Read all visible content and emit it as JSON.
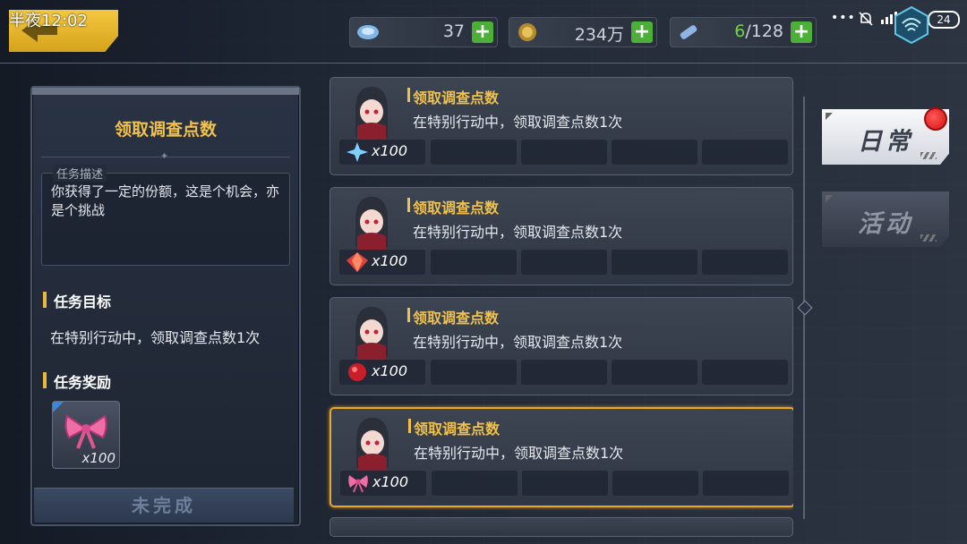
{
  "statusbar": {
    "time": "半夜12:02",
    "dots": "•••",
    "battery": "24"
  },
  "resources": [
    {
      "icon": "crystal-icon",
      "value": "37",
      "highlight": ""
    },
    {
      "icon": "coin-icon",
      "value": "234万",
      "highlight": ""
    },
    {
      "icon": "battery-item-icon",
      "value": "/128",
      "highlight": "6"
    }
  ],
  "detail": {
    "title": "领取调查点数",
    "desc_label": "任务描述",
    "desc_text": "你获得了一定的份额，这是个机会，亦是个挑战",
    "goal_heading": "任务目标",
    "goal_text": "在特别行动中，领取调查点数1次",
    "reward_heading": "任务奖励",
    "reward_qty": "x100",
    "status": "未完成"
  },
  "missions": [
    {
      "title": "领取调查点数",
      "desc": "在特别行动中，领取调查点数1次",
      "reward_icon": "blue-crystal-icon",
      "reward_qty": "x100"
    },
    {
      "title": "领取调查点数",
      "desc": "在特别行动中，领取调查点数1次",
      "reward_icon": "red-gem-icon",
      "reward_qty": "x100"
    },
    {
      "title": "领取调查点数",
      "desc": "在特别行动中，领取调查点数1次",
      "reward_icon": "ruby-icon",
      "reward_qty": "x100"
    },
    {
      "title": "领取调查点数",
      "desc": "在特别行动中，领取调查点数1次",
      "reward_icon": "bow-icon",
      "reward_qty": "x100"
    }
  ],
  "tabs": {
    "daily": "日常",
    "event": "活动"
  },
  "colors": {
    "accent": "#f2c14a",
    "active_border": "#e8a725",
    "plus": "#4caf37"
  }
}
